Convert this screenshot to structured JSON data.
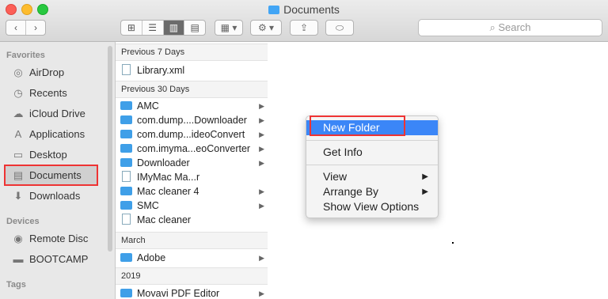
{
  "window": {
    "title": "Documents"
  },
  "toolbar": {
    "back": "‹",
    "forward": "›",
    "view_icons": [
      "⊞",
      "☰",
      "▥",
      "▤"
    ],
    "arrange": "▦ ▾",
    "action": "⚙ ▾",
    "share": "⇪",
    "tags": "⬭"
  },
  "search": {
    "placeholder": "Search",
    "icon": "magnifier-icon"
  },
  "sidebar": {
    "favorites_header": "Favorites",
    "favorites": [
      {
        "label": "AirDrop",
        "icon": "airdrop-icon",
        "glyph": "◎"
      },
      {
        "label": "Recents",
        "icon": "clock-icon",
        "glyph": "◷"
      },
      {
        "label": "iCloud Drive",
        "icon": "cloud-icon",
        "glyph": "☁"
      },
      {
        "label": "Applications",
        "icon": "applications-icon",
        "glyph": "A"
      },
      {
        "label": "Desktop",
        "icon": "desktop-icon",
        "glyph": "▭"
      },
      {
        "label": "Documents",
        "icon": "documents-icon",
        "glyph": "▤"
      },
      {
        "label": "Downloads",
        "icon": "download-icon",
        "glyph": "⬇"
      }
    ],
    "devices_header": "Devices",
    "devices": [
      {
        "label": "Remote Disc",
        "icon": "disc-icon",
        "glyph": "◉"
      },
      {
        "label": "BOOTCAMP",
        "icon": "drive-icon",
        "glyph": "▬"
      }
    ],
    "tags_header": "Tags"
  },
  "column1": {
    "groups": [
      {
        "title": "Previous 7 Days"
      },
      {
        "title": "Previous 30 Days"
      },
      {
        "title": "March"
      },
      {
        "title": "2019"
      }
    ],
    "items": [
      {
        "label": "Library.xml",
        "type": "doc",
        "arrow": ""
      },
      {
        "label": "AMC",
        "type": "folder",
        "arrow": "▶"
      },
      {
        "label": "com.dump....Downloader",
        "type": "folder",
        "arrow": "▶"
      },
      {
        "label": "com.dump...ideoConvert",
        "type": "folder",
        "arrow": "▶"
      },
      {
        "label": "com.imyma...eoConverter",
        "type": "folder",
        "arrow": "▶"
      },
      {
        "label": "Downloader",
        "type": "folder",
        "arrow": "▶"
      },
      {
        "label": "IMyMac Ma...r",
        "type": "doc",
        "arrow": ""
      },
      {
        "label": "Mac cleaner 4",
        "type": "folder",
        "arrow": "▶"
      },
      {
        "label": "SMC",
        "type": "folder",
        "arrow": "▶"
      },
      {
        "label": "Mac cleaner",
        "type": "doc",
        "arrow": ""
      },
      {
        "label": "Adobe",
        "type": "folder",
        "arrow": "▶"
      },
      {
        "label": "Movavi PDF Editor",
        "type": "folder",
        "arrow": "▶"
      }
    ]
  },
  "context_menu": {
    "items": [
      {
        "label": "New Folder",
        "submenu": ""
      },
      {
        "label": "Get Info",
        "submenu": ""
      },
      {
        "label": "View",
        "submenu": "▶"
      },
      {
        "label": "Arrange By",
        "submenu": "▶"
      },
      {
        "label": "Show View Options",
        "submenu": ""
      }
    ]
  }
}
